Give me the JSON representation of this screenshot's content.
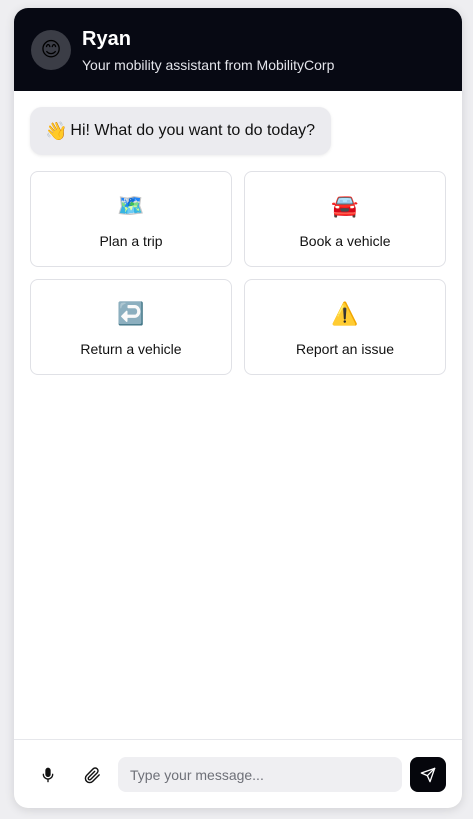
{
  "header": {
    "avatar_emoji": "😊",
    "name": "Ryan",
    "subtitle": "Your mobility assistant from MobilityCorp"
  },
  "greeting": {
    "emoji": "👋",
    "text": "Hi! What do you want to do today?"
  },
  "actions": [
    {
      "icon": "🗺️",
      "icon_name": "map-icon",
      "label": "Plan a trip"
    },
    {
      "icon": "🚘",
      "icon_name": "car-icon",
      "label": "Book a vehicle"
    },
    {
      "icon": "↩️",
      "icon_name": "return-arrow-icon",
      "label": "Return a vehicle"
    },
    {
      "icon": "⚠️",
      "icon_name": "warning-icon",
      "label": "Report an issue"
    }
  ],
  "composer": {
    "placeholder": "Type your message...",
    "mic_icon": "microphone-icon",
    "attach_icon": "paperclip-icon",
    "send_icon": "send-icon"
  },
  "colors": {
    "header_bg": "#070913",
    "send_button_bg": "#05060c",
    "bubble_bg": "#ebebef"
  }
}
